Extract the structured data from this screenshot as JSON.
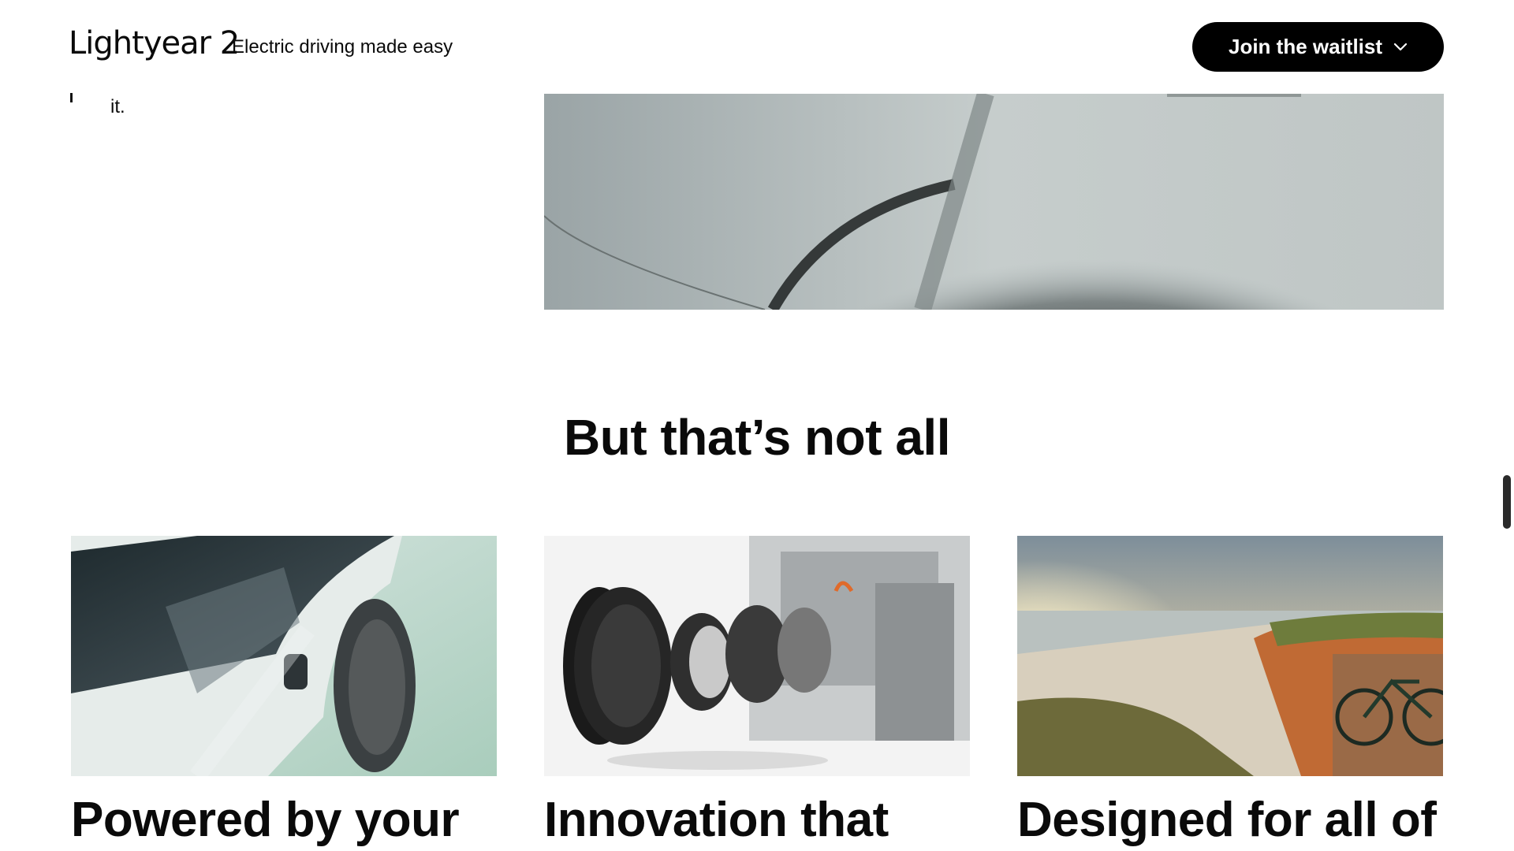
{
  "header": {
    "brand": "Lightyear 2",
    "tagline": "Electric driving made easy",
    "waitlist_label": "Join the waitlist"
  },
  "intro": {
    "partial_text": "it."
  },
  "section": {
    "heading": "But that’s not all"
  },
  "cards": [
    {
      "title": "Powered by your"
    },
    {
      "title": "Innovation that"
    },
    {
      "title": "Designed for all of"
    }
  ],
  "icons": {
    "waitlist_dropdown": "chevron-down-icon"
  },
  "colors": {
    "button_bg": "#000000",
    "button_text": "#ffffff",
    "text": "#0a0a0a"
  }
}
